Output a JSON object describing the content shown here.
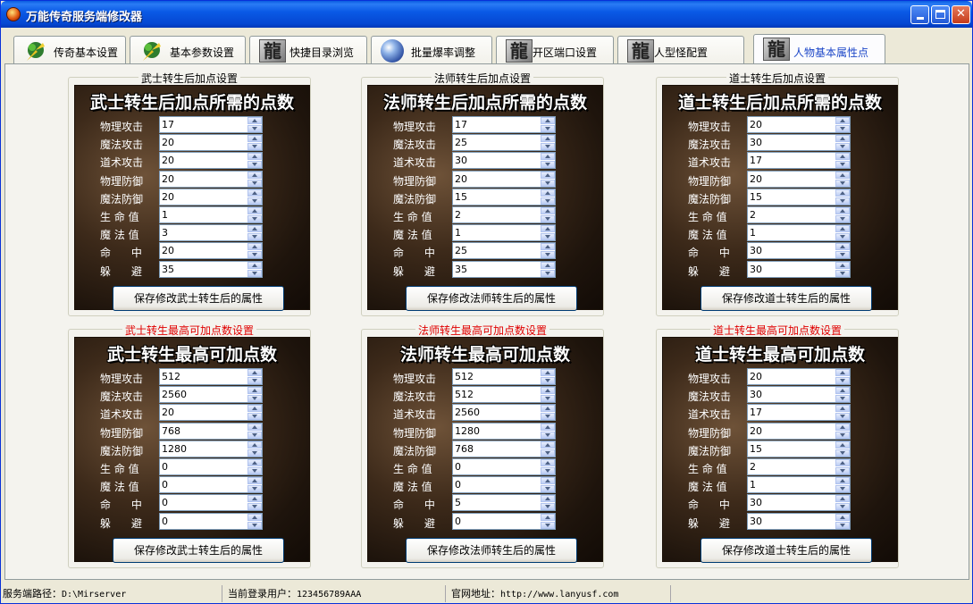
{
  "window": {
    "title": "万能传奇服务端修改器"
  },
  "tabs": [
    {
      "label": "传奇基本设置",
      "icon": "arrow-tree-icon"
    },
    {
      "label": "基本参数设置",
      "icon": "arrow-tree-icon"
    },
    {
      "label": "快捷目录浏览",
      "icon": "dragon-character-icon"
    },
    {
      "label": "批量爆率调整",
      "icon": "globe-icon"
    },
    {
      "label": "开区端口设置",
      "icon": "dragon-character-icon"
    },
    {
      "label": "人型怪配置",
      "icon": "dragon-character-icon"
    },
    {
      "label": "人物基本属性点",
      "icon": "dragon-character-icon",
      "active": true
    }
  ],
  "field_labels": [
    "物理攻击",
    "魔法攻击",
    "道术攻击",
    "物理防御",
    "魔法防御",
    "生 命 值",
    "魔 法 值",
    "命      中",
    "躲      避"
  ],
  "groups": [
    {
      "title": "武士转生后加点设置",
      "heading": "武士转生后加点所需的点数",
      "values": [
        "17",
        "20",
        "20",
        "20",
        "20",
        "1",
        "3",
        "20",
        "35"
      ],
      "button": "保存修改武士转生后的属性"
    },
    {
      "title": "法师转生后加点设置",
      "heading": "法师转生后加点所需的点数",
      "values": [
        "17",
        "25",
        "30",
        "20",
        "15",
        "2",
        "1",
        "25",
        "35"
      ],
      "button": "保存修改法师转生后的属性"
    },
    {
      "title": "道士转生后加点设置",
      "heading": "道士转生后加点所需的点数",
      "values": [
        "20",
        "30",
        "17",
        "20",
        "15",
        "2",
        "1",
        "30",
        "30"
      ],
      "button": "保存修改道士转生后的属性"
    },
    {
      "title": "武士转生最高可加点数设置",
      "heading": "武士转生最高可加点数",
      "values": [
        "512",
        "2560",
        "20",
        "768",
        "1280",
        "0",
        "0",
        "0",
        "0"
      ],
      "button": "保存修改武士转生后的属性"
    },
    {
      "title": "法师转生最高可加点数设置",
      "heading": "法师转生最高可加点数",
      "values": [
        "512",
        "512",
        "2560",
        "1280",
        "768",
        "0",
        "0",
        "5",
        "0"
      ],
      "button": "保存修改法师转生后的属性"
    },
    {
      "title": "道士转生最高可加点数设置",
      "heading": "道士转生最高可加点数",
      "values": [
        "20",
        "30",
        "17",
        "20",
        "15",
        "2",
        "1",
        "30",
        "30"
      ],
      "button": "保存修改道士转生后的属性"
    }
  ],
  "status": {
    "server_path_label": "服务端路径：",
    "server_path": "D:\\Mirserver",
    "user_label": "当前登录用户：",
    "user": "123456789AAA",
    "site_label": "官网地址：",
    "site": "http://www.lanyusf.com"
  },
  "colors": {
    "title_bar": "#0a5ae6",
    "group_title_red": "#e00000",
    "active_tab_text": "#1d47c8"
  }
}
